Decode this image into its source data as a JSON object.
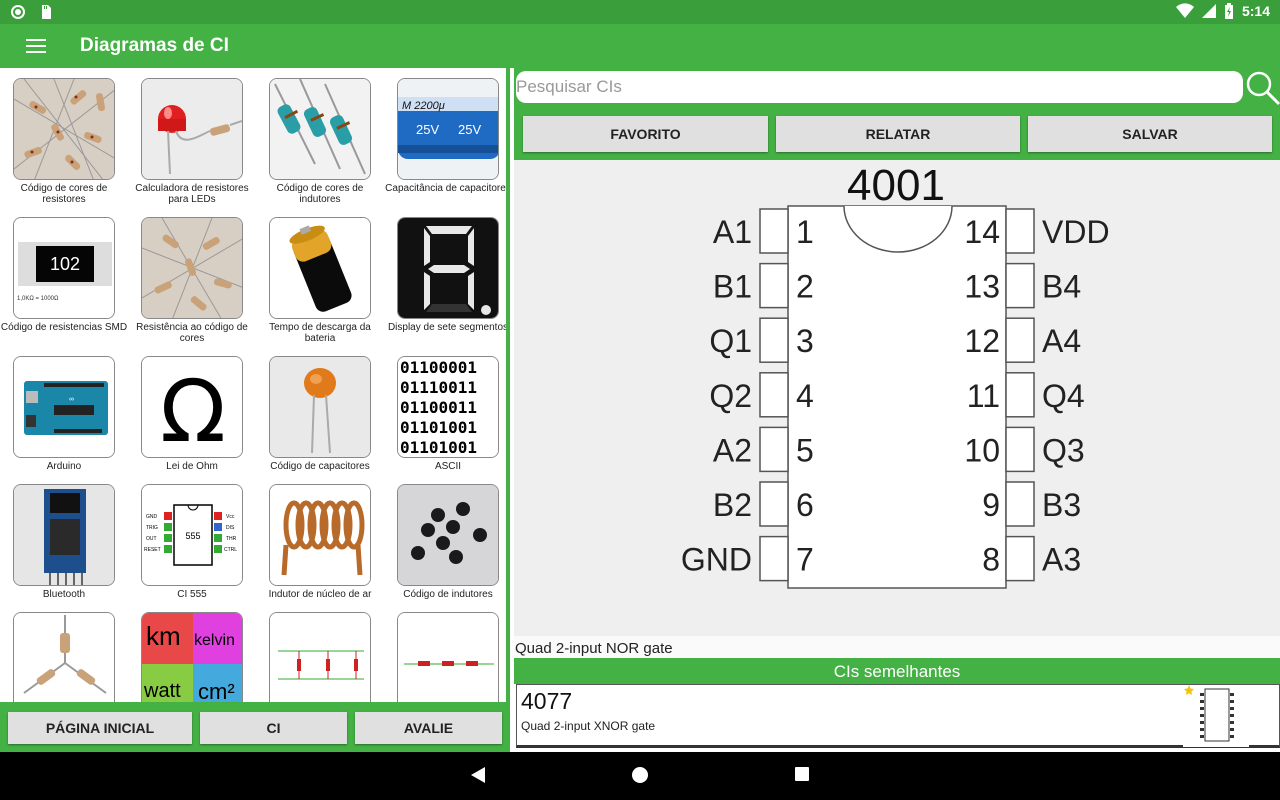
{
  "status": {
    "time": "5:14"
  },
  "appbar": {
    "title": "Diagramas de CI"
  },
  "tiles": [
    {
      "caption": "Código de cores de resistores"
    },
    {
      "caption": "Calculadora de resistores para LEDs"
    },
    {
      "caption": "Código de cores de indutores"
    },
    {
      "caption": "Capacitância de capacitores"
    },
    {
      "caption": "Código de resistencias SMD"
    },
    {
      "caption": "Resistência ao código de cores"
    },
    {
      "caption": "Tempo de descarga da bateria"
    },
    {
      "caption": "Display de sete segmentos"
    },
    {
      "caption": "Arduino"
    },
    {
      "caption": "Lei de Ohm"
    },
    {
      "caption": "Código de capacitores"
    },
    {
      "caption": "ASCII"
    },
    {
      "caption": "Bluetooth"
    },
    {
      "caption": "CI 555"
    },
    {
      "caption": "Indutor de núcleo de ar"
    },
    {
      "caption": "Código de indutores"
    },
    {
      "caption": ""
    },
    {
      "caption": ""
    },
    {
      "caption": ""
    },
    {
      "caption": ""
    }
  ],
  "tile_art": {
    "smd_code": "102",
    "smd_note": "1,0KΩ = 1000Ω",
    "capacitor_label": "25V",
    "capacitor_brand": "M 2200μ",
    "ohm_symbol": "Ω",
    "ascii_lines": [
      "01100001",
      "01110011",
      "01100011",
      "01101001",
      "01101001"
    ],
    "ic555_label": "555",
    "ic555_left_pins": [
      "GND",
      "TRIG",
      "OUT",
      "RESET"
    ],
    "ic555_right_pins": [
      "Vcc",
      "DIS",
      "THR",
      "CTRL"
    ],
    "unit_words": [
      "km",
      "kelvin",
      "watt",
      "cm²"
    ]
  },
  "left_buttons": {
    "home": "PÁGINA INICIAL",
    "ci": "CI",
    "rate": "AVALIE"
  },
  "search": {
    "placeholder": "Pesquisar CIs",
    "value": ""
  },
  "actions": {
    "favorite": "FAVORITO",
    "report": "RELATAR",
    "save": "SALVAR"
  },
  "chip": {
    "name": "4001",
    "left_pins": [
      {
        "label": "A1",
        "num": "1"
      },
      {
        "label": "B1",
        "num": "2"
      },
      {
        "label": "Q1",
        "num": "3"
      },
      {
        "label": "Q2",
        "num": "4"
      },
      {
        "label": "A2",
        "num": "5"
      },
      {
        "label": "B2",
        "num": "6"
      },
      {
        "label": "GND",
        "num": "7"
      }
    ],
    "right_pins": [
      {
        "label": "VDD",
        "num": "14"
      },
      {
        "label": "B4",
        "num": "13"
      },
      {
        "label": "A4",
        "num": "12"
      },
      {
        "label": "Q4",
        "num": "11"
      },
      {
        "label": "Q3",
        "num": "10"
      },
      {
        "label": "B3",
        "num": "9"
      },
      {
        "label": "A3",
        "num": "8"
      }
    ],
    "description": "Quad 2-input NOR gate"
  },
  "similar": {
    "title": "CIs semelhantes",
    "items": [
      {
        "num": "4077",
        "desc": "Quad 2-input XNOR gate"
      }
    ]
  },
  "colors": {
    "accent": "#44b144",
    "status": "#3a9e3a"
  }
}
